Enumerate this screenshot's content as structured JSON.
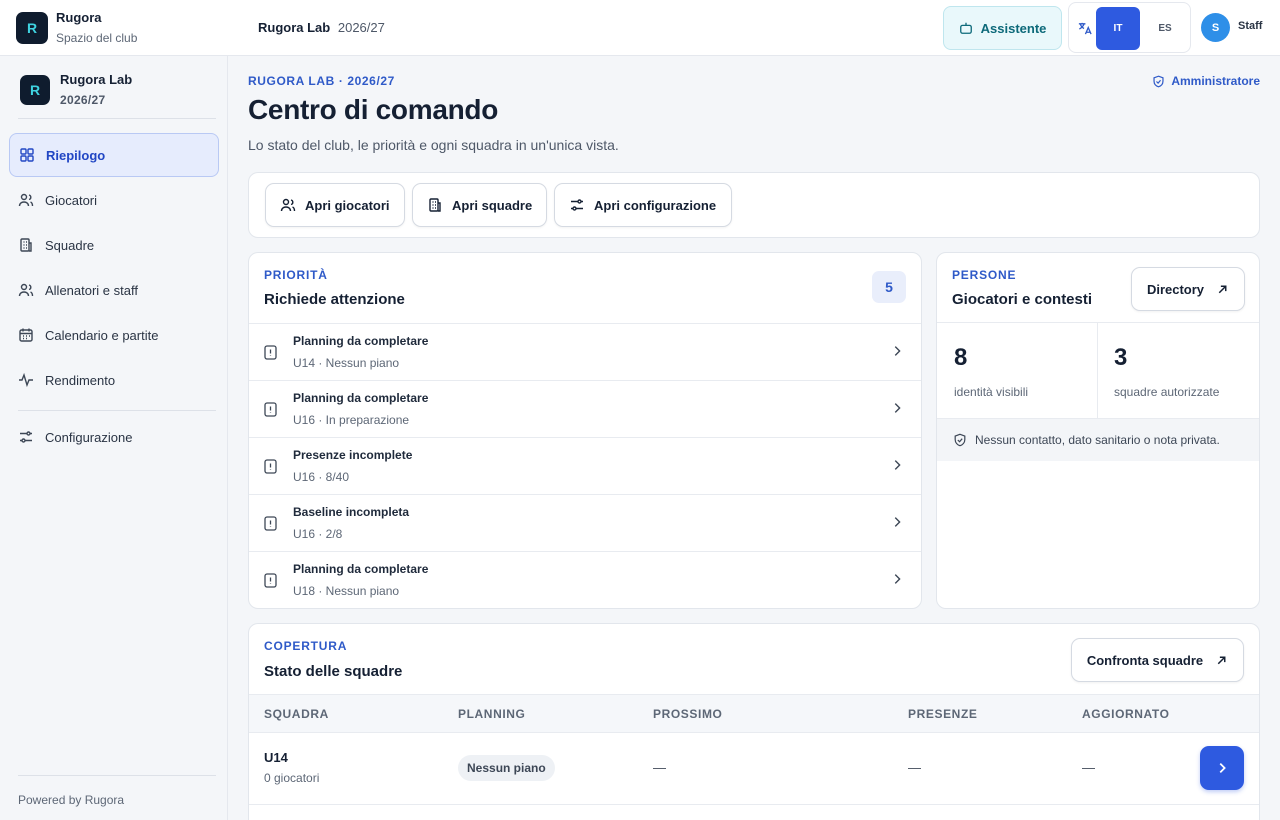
{
  "topbar": {
    "brand_name": "Rugora",
    "brand_sub": "Spazio del club",
    "context_club": "Rugora Lab",
    "context_season": "2026/27",
    "assistant_label": "Assistente",
    "lang_active": "IT",
    "lang_other": "ES",
    "user_initial": "S",
    "user_label": "Staff"
  },
  "sidebar": {
    "org_name": "Rugora Lab",
    "org_season": "2026/27",
    "items": [
      {
        "label": "Riepilogo",
        "icon": "grid-icon",
        "active": true
      },
      {
        "label": "Giocatori",
        "icon": "users-icon"
      },
      {
        "label": "Squadre",
        "icon": "building-icon"
      },
      {
        "label": "Allenatori e staff",
        "icon": "users-icon"
      },
      {
        "label": "Calendario e partite",
        "icon": "calendar-icon"
      },
      {
        "label": "Rendimento",
        "icon": "activity-icon"
      },
      {
        "label": "Configurazione",
        "icon": "sliders-icon"
      }
    ],
    "powered_by": "Powered by Rugora"
  },
  "header": {
    "eyebrow": "RUGORA LAB · 2026/27",
    "role": "Amministratore",
    "title": "Centro di comando",
    "subtitle": "Lo stato del club, le priorità e ogni squadra in un'unica vista."
  },
  "quick_actions": [
    "Apri giocatori",
    "Apri squadre",
    "Apri configurazione"
  ],
  "priority": {
    "eyebrow": "PRIORITÀ",
    "title": "Richiede attenzione",
    "count": "5",
    "items": [
      {
        "title": "Planning da completare",
        "sub": "U14 · Nessun piano"
      },
      {
        "title": "Planning da completare",
        "sub": "U16 · In preparazione"
      },
      {
        "title": "Presenze incomplete",
        "sub": "U16 · 8/40"
      },
      {
        "title": "Baseline incompleta",
        "sub": "U16 · 2/8"
      },
      {
        "title": "Planning da completare",
        "sub": "U18 · Nessun piano"
      }
    ]
  },
  "people": {
    "eyebrow": "PERSONE",
    "title": "Giocatori e contesti",
    "directory_label": "Directory",
    "stat1_value": "8",
    "stat1_label": "identità visibili",
    "stat2_value": "3",
    "stat2_label": "squadre autorizzate",
    "privacy_note": "Nessun contatto, dato sanitario o nota privata."
  },
  "coverage": {
    "eyebrow": "COPERTURA",
    "title": "Stato delle squadre",
    "compare_label": "Confronta squadre",
    "columns": [
      "SQUADRA",
      "PLANNING",
      "PROSSIMO",
      "PRESENZE",
      "AGGIORNATO"
    ],
    "rows": [
      {
        "team": "U14",
        "players": "0 giocatori",
        "planning": "Nessun piano",
        "next": "—",
        "attendance": "—",
        "updated": "—"
      }
    ]
  },
  "colors": {
    "accent": "#2e5ae0",
    "eyebrow": "#2f5ac8",
    "assistant": "#0d6a7a"
  }
}
